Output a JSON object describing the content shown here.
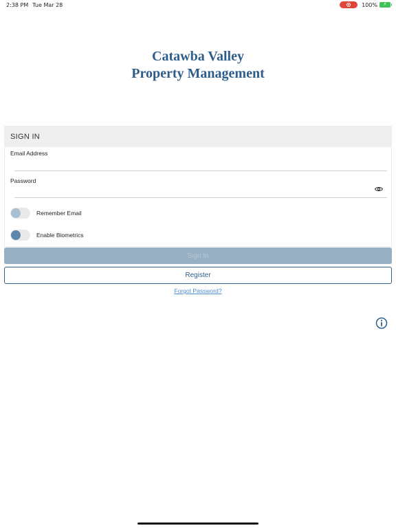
{
  "status_bar": {
    "time": "2:38 PM",
    "date": "Tue Mar 28",
    "battery_percent": "100%",
    "recording_color": "#e0453a",
    "battery_color": "#3fc25a"
  },
  "logo": {
    "line1": "Catawba Valley",
    "line2": "Property Management",
    "color": "#2f5d8a"
  },
  "sign_in_form": {
    "header": "SIGN IN",
    "email": {
      "label": "Email Address",
      "value": "",
      "placeholder": ""
    },
    "password": {
      "label": "Password",
      "value": "",
      "placeholder": ""
    },
    "remember_email": {
      "label": "Remember Email",
      "on": false
    },
    "enable_biometrics": {
      "label": "Enable Biometrics",
      "on": false
    }
  },
  "buttons": {
    "sign_in": "Sign In",
    "register": "Register",
    "forgot_password": "Forgot Password?"
  },
  "icons": {
    "recording": "recording-indicator-icon",
    "battery": "battery-charging-icon",
    "password_toggle": "eye-icon",
    "info": "info-icon"
  },
  "colors": {
    "accent": "#2f5d8a",
    "sign_in_disabled": "#98b0c3",
    "link": "#4a8ad0",
    "header_bg": "#efefef"
  }
}
